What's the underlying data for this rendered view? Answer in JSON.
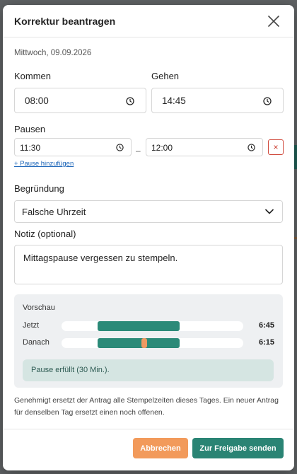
{
  "modal": {
    "title": "Korrektur beantragen",
    "date": "Mittwoch, 09.09.2026"
  },
  "kommen": {
    "label": "Kommen",
    "value": "08:00"
  },
  "gehen": {
    "label": "Gehen",
    "value": "14:45"
  },
  "pausen": {
    "label": "Pausen",
    "start": "11:30",
    "separator": "–",
    "end": "12:00",
    "remove_glyph": "×",
    "add_link": "+ Pause hinzufügen"
  },
  "begruendung": {
    "label": "Begründung",
    "selected": "Falsche Uhrzeit"
  },
  "notiz": {
    "label": "Notiz (optional)",
    "value": "Mittagspause vergessen zu stempeln."
  },
  "preview": {
    "title": "Vorschau",
    "rows": [
      {
        "label": "Jetzt",
        "value": "6:45",
        "bar_start": 0.2,
        "bar_end": 0.65,
        "pause": null
      },
      {
        "label": "Danach",
        "value": "6:15",
        "bar_start": 0.2,
        "bar_end": 0.65,
        "pause": 0.44
      }
    ],
    "status": "Pause erfüllt (30 Min.)."
  },
  "info": "Genehmigt ersetzt der Antrag alle Stempelzeiten dieses Tages. Ein neuer Antrag für denselben Tag ersetzt einen noch offenen.",
  "buttons": {
    "cancel": "Abbrechen",
    "submit": "Zur Freigabe senden"
  },
  "colors": {
    "accent": "#2a8474",
    "cancel": "#f29a5b",
    "remove": "#c9382a",
    "link": "#1a64b8"
  },
  "icons": {
    "close": "close-icon",
    "clock": "clock-icon",
    "chevron": "chevron-down-icon",
    "remove": "close-icon"
  }
}
